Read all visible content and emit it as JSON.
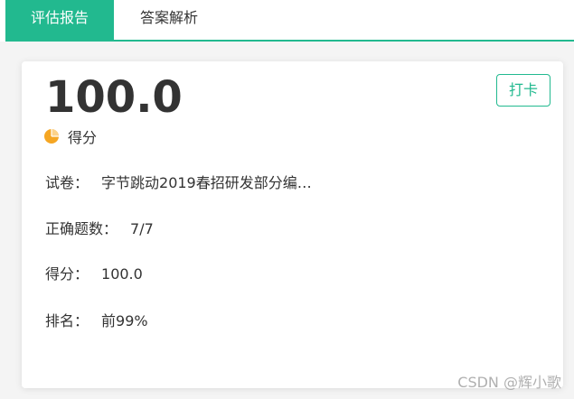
{
  "tabs": [
    {
      "label": "评估报告",
      "active": true
    },
    {
      "label": "答案解析",
      "active": false
    }
  ],
  "accent_color": "#22b98f",
  "report": {
    "score_big": "100.0",
    "score_caption": "得分",
    "score_icon": "pie-chart-icon",
    "punch_button": "打卡",
    "paper_label": "试卷：",
    "paper_value": "字节跳动2019春招研发部分编…",
    "correct_label": "正确题数：",
    "correct_value": "7/7",
    "score_label": "得分：",
    "score_value": "100.0",
    "rank_label": "排名：",
    "rank_value": "前99%"
  },
  "watermark": "CSDN @辉小歌"
}
